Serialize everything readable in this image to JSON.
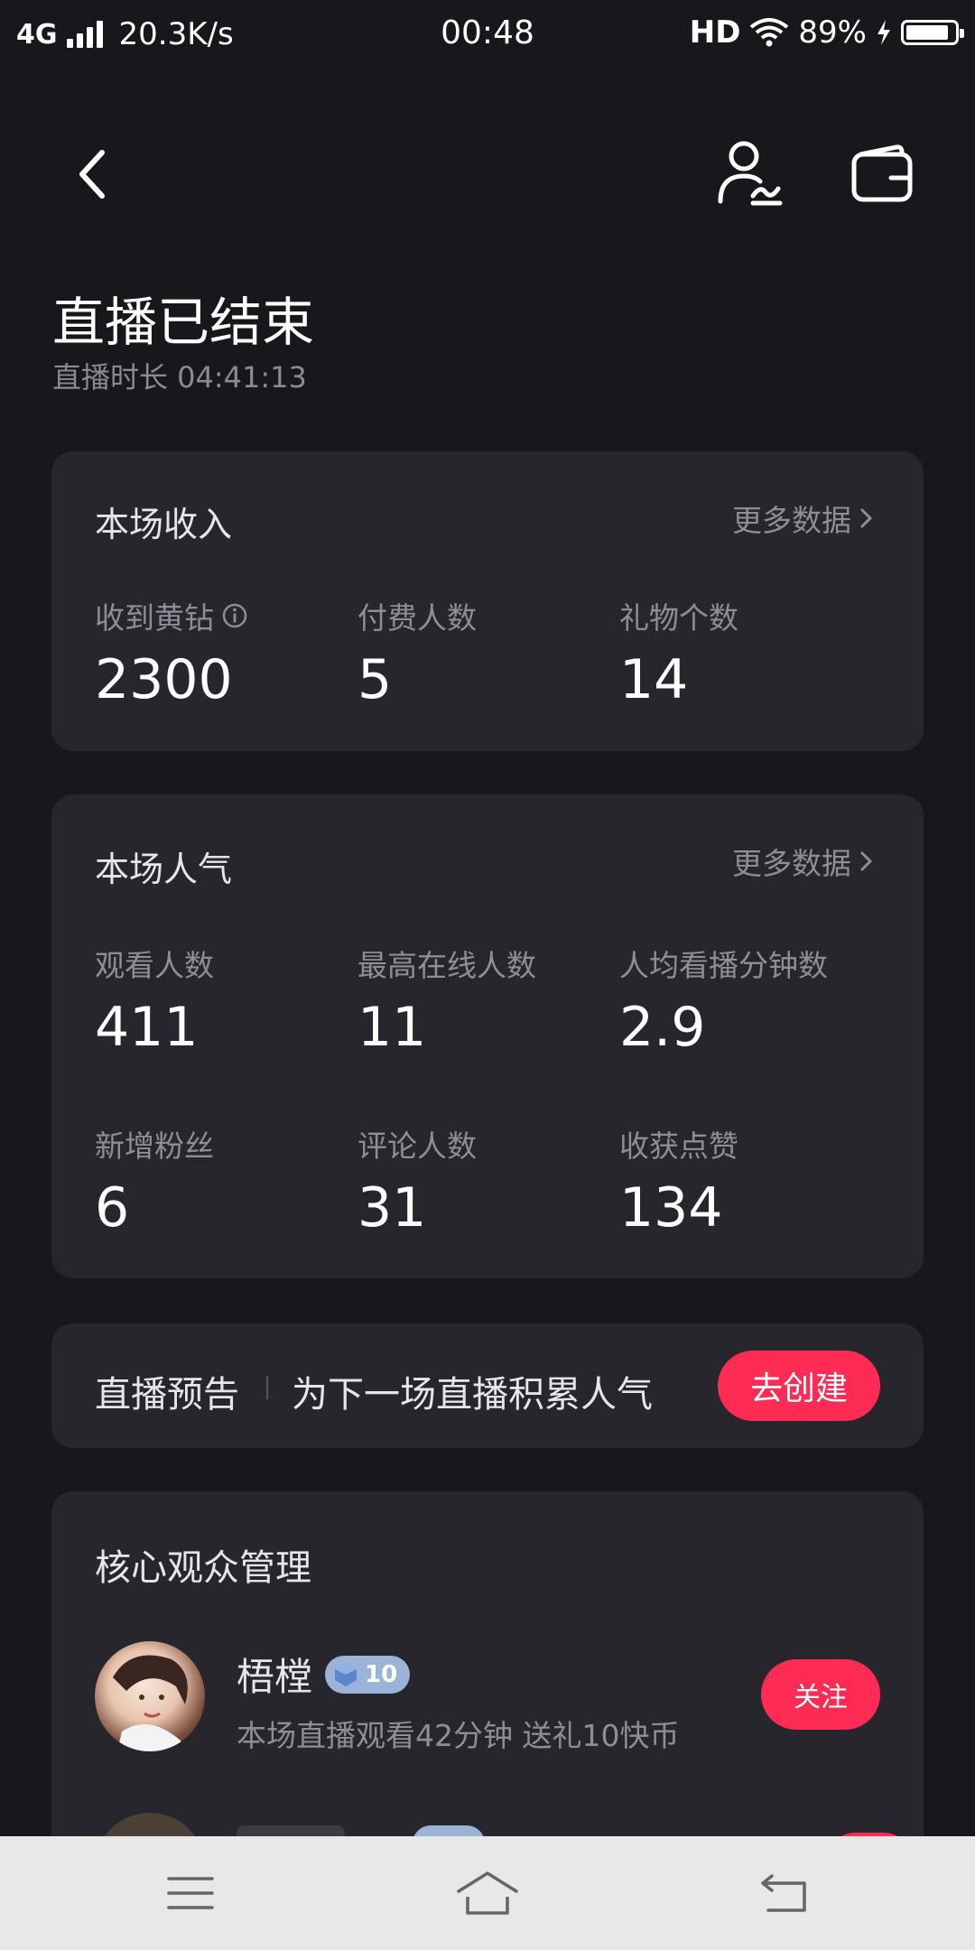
{
  "status_bar": {
    "network": "4G",
    "speed": "20.3K/s",
    "time": "00:48",
    "hd": "HD",
    "battery_pct": "89%",
    "battery_level": 0.89
  },
  "header": {
    "title": "直播已结束",
    "duration": "直播时长 04:41:13"
  },
  "income": {
    "title": "本场收入",
    "more": "更多数据",
    "metrics": [
      {
        "label": "收到黄钻",
        "value": "2300"
      },
      {
        "label": "付费人数",
        "value": "5"
      },
      {
        "label": "礼物个数",
        "value": "14"
      }
    ]
  },
  "popularity": {
    "title": "本场人气",
    "more": "更多数据",
    "metrics": [
      {
        "label": "观看人数",
        "value": "411"
      },
      {
        "label": "最高在线人数",
        "value": "11"
      },
      {
        "label": "人均看播分钟数",
        "value": "2.9"
      },
      {
        "label": "新增粉丝",
        "value": "6"
      },
      {
        "label": "评论人数",
        "value": "31"
      },
      {
        "label": "收获点赞",
        "value": "134"
      }
    ]
  },
  "preview": {
    "title": "直播预告",
    "subtitle": "为下一场直播积累人气",
    "button": "去创建"
  },
  "audience": {
    "title": "核心观众管理",
    "users": [
      {
        "name": "梧樘",
        "level": "10",
        "detail": "本场直播观看42分钟 送礼10快币",
        "follow": "关注"
      }
    ]
  },
  "colors": {
    "accent": "#fe2c55",
    "card": "#26262c",
    "background": "#17171c"
  }
}
